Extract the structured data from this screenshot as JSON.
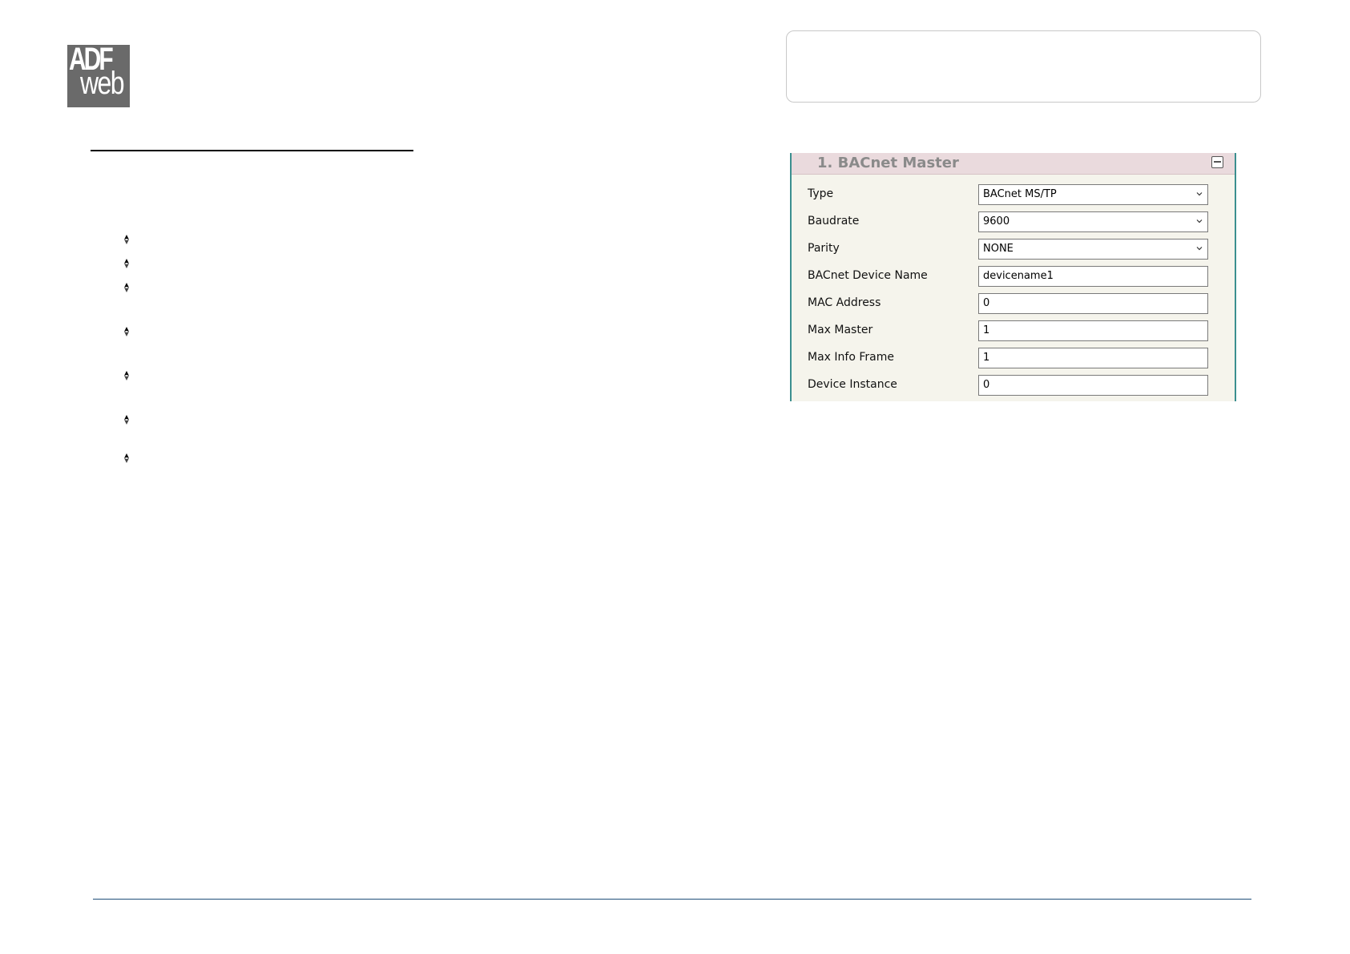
{
  "logo": {
    "top_text": "ADF",
    "bottom_text": "web"
  },
  "panel": {
    "title": "1. BACnet Master",
    "rows": [
      {
        "label": "Type",
        "value": "BACnet MS/TP",
        "kind": "select"
      },
      {
        "label": "Baudrate",
        "value": "9600",
        "kind": "select"
      },
      {
        "label": "Parity",
        "value": "NONE",
        "kind": "select"
      },
      {
        "label": "BACnet Device Name",
        "value": "devicename1",
        "kind": "input"
      },
      {
        "label": "MAC Address",
        "value": "0",
        "kind": "input"
      },
      {
        "label": "Max Master",
        "value": "1",
        "kind": "input"
      },
      {
        "label": "Max Info Frame",
        "value": "1",
        "kind": "input"
      },
      {
        "label": "Device Instance",
        "value": "0",
        "kind": "input"
      }
    ]
  },
  "colors": {
    "panel_border": "#3b8f8f",
    "panel_header": "#eadadd",
    "panel_bg": "#f5f4ec",
    "footer_rule": "#1f4e79"
  },
  "icons": {
    "bullet": "arrow-diamond-bullet-icon",
    "collapse": "collapse-minus-icon",
    "dropdown": "chevron-down-icon"
  }
}
